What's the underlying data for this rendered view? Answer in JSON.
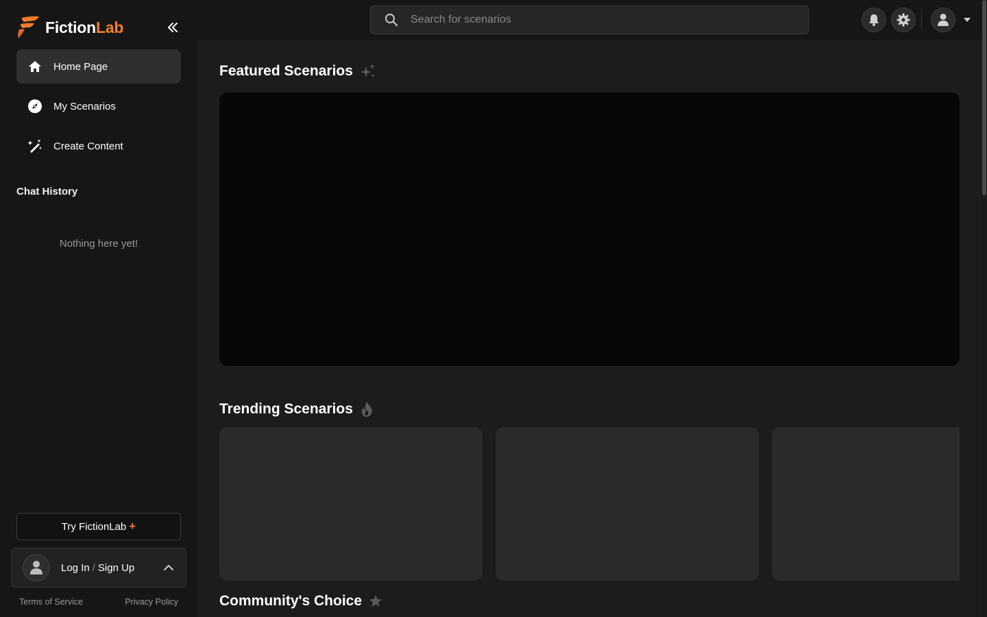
{
  "brand": {
    "name_part1": "Fiction",
    "name_part2": "Lab",
    "accent_color": "#f47c2c"
  },
  "sidebar": {
    "collapse_icon": "double-chevron-left-icon",
    "items": [
      {
        "label": "Home Page",
        "icon": "home-icon",
        "active": true
      },
      {
        "label": "My Scenarios",
        "icon": "compass-icon",
        "active": false
      },
      {
        "label": "Create Content",
        "icon": "magic-wand-icon",
        "active": false
      }
    ],
    "chat_history_title": "Chat History",
    "chat_history_empty": "Nothing here yet!",
    "try_button": {
      "label": "Try FictionLab",
      "plus": "+"
    },
    "login": {
      "login": "Log In",
      "separator": "/",
      "signup": "Sign Up"
    },
    "footer": {
      "terms": "Terms of Service",
      "privacy": "Privacy Policy"
    }
  },
  "topbar": {
    "search_placeholder": "Search for scenarios",
    "icons": [
      "bell-icon",
      "gear-icon",
      "user-icon",
      "caret-down-icon"
    ]
  },
  "main": {
    "featured_title": "Featured Scenarios",
    "trending_title": "Trending Scenarios",
    "community_title": "Community's Choice"
  }
}
